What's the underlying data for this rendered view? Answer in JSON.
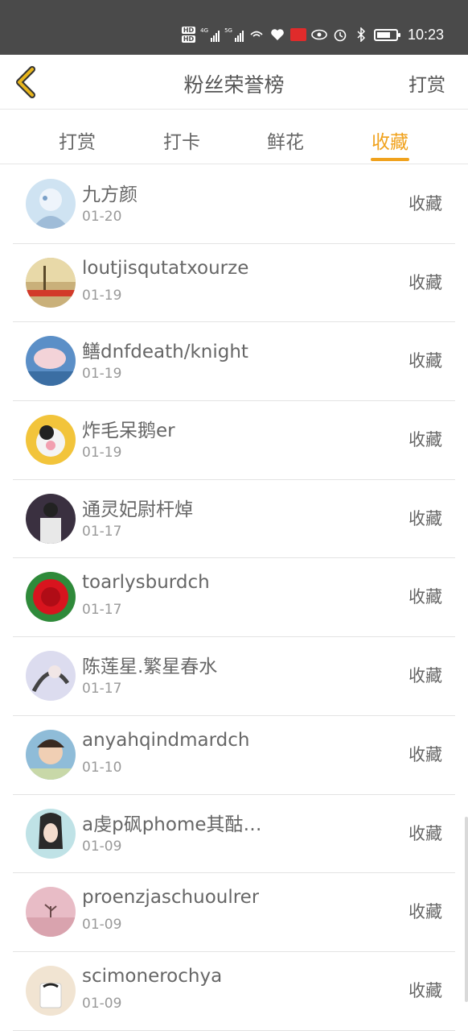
{
  "status_bar": {
    "time": "10:23",
    "hd_badges": [
      "HD",
      "HD"
    ],
    "network_1": "4G",
    "network_2": "5G",
    "icons": [
      "hd-icon",
      "signal-icon",
      "signal-icon",
      "hotspot-icon",
      "heart-icon",
      "app-badge-icon",
      "eye-icon",
      "alarm-icon",
      "bluetooth-icon",
      "battery-icon"
    ]
  },
  "header": {
    "back_icon": "chevron-left-icon",
    "title": "粉丝荣誉榜",
    "action_label": "打赏"
  },
  "tabs": [
    {
      "label": "打赏",
      "active": false
    },
    {
      "label": "打卡",
      "active": false
    },
    {
      "label": "鲜花",
      "active": false
    },
    {
      "label": "收藏",
      "active": true
    }
  ],
  "list": [
    {
      "name": "九方颜",
      "date": "01-20",
      "action": "收藏"
    },
    {
      "name": "loutjisqutatxourze",
      "date": "01-19",
      "action": "收藏"
    },
    {
      "name": "鳝dnfdeath/knight",
      "date": "01-19",
      "action": "收藏"
    },
    {
      "name": "炸毛呆鹅er",
      "date": "01-19",
      "action": "收藏"
    },
    {
      "name": "通灵妃尉杆焯",
      "date": "01-17",
      "action": "收藏"
    },
    {
      "name": "toarlysburdch",
      "date": "01-17",
      "action": "收藏"
    },
    {
      "name": "陈莲星.繁星春水",
      "date": "01-17",
      "action": "收藏"
    },
    {
      "name": "anyahqindmardch",
      "date": "01-10",
      "action": "收藏"
    },
    {
      "name": "a虔p砜phome其酤…",
      "date": "01-09",
      "action": "收藏"
    },
    {
      "name": "proenzjaschuoulrer",
      "date": "01-09",
      "action": "收藏"
    },
    {
      "name": "scimonerochya",
      "date": "01-09",
      "action": "收藏"
    }
  ],
  "colors": {
    "accent": "#f0a21d",
    "status_bar_bg": "#4a4a4a",
    "back_icon": "#e8b51c"
  }
}
